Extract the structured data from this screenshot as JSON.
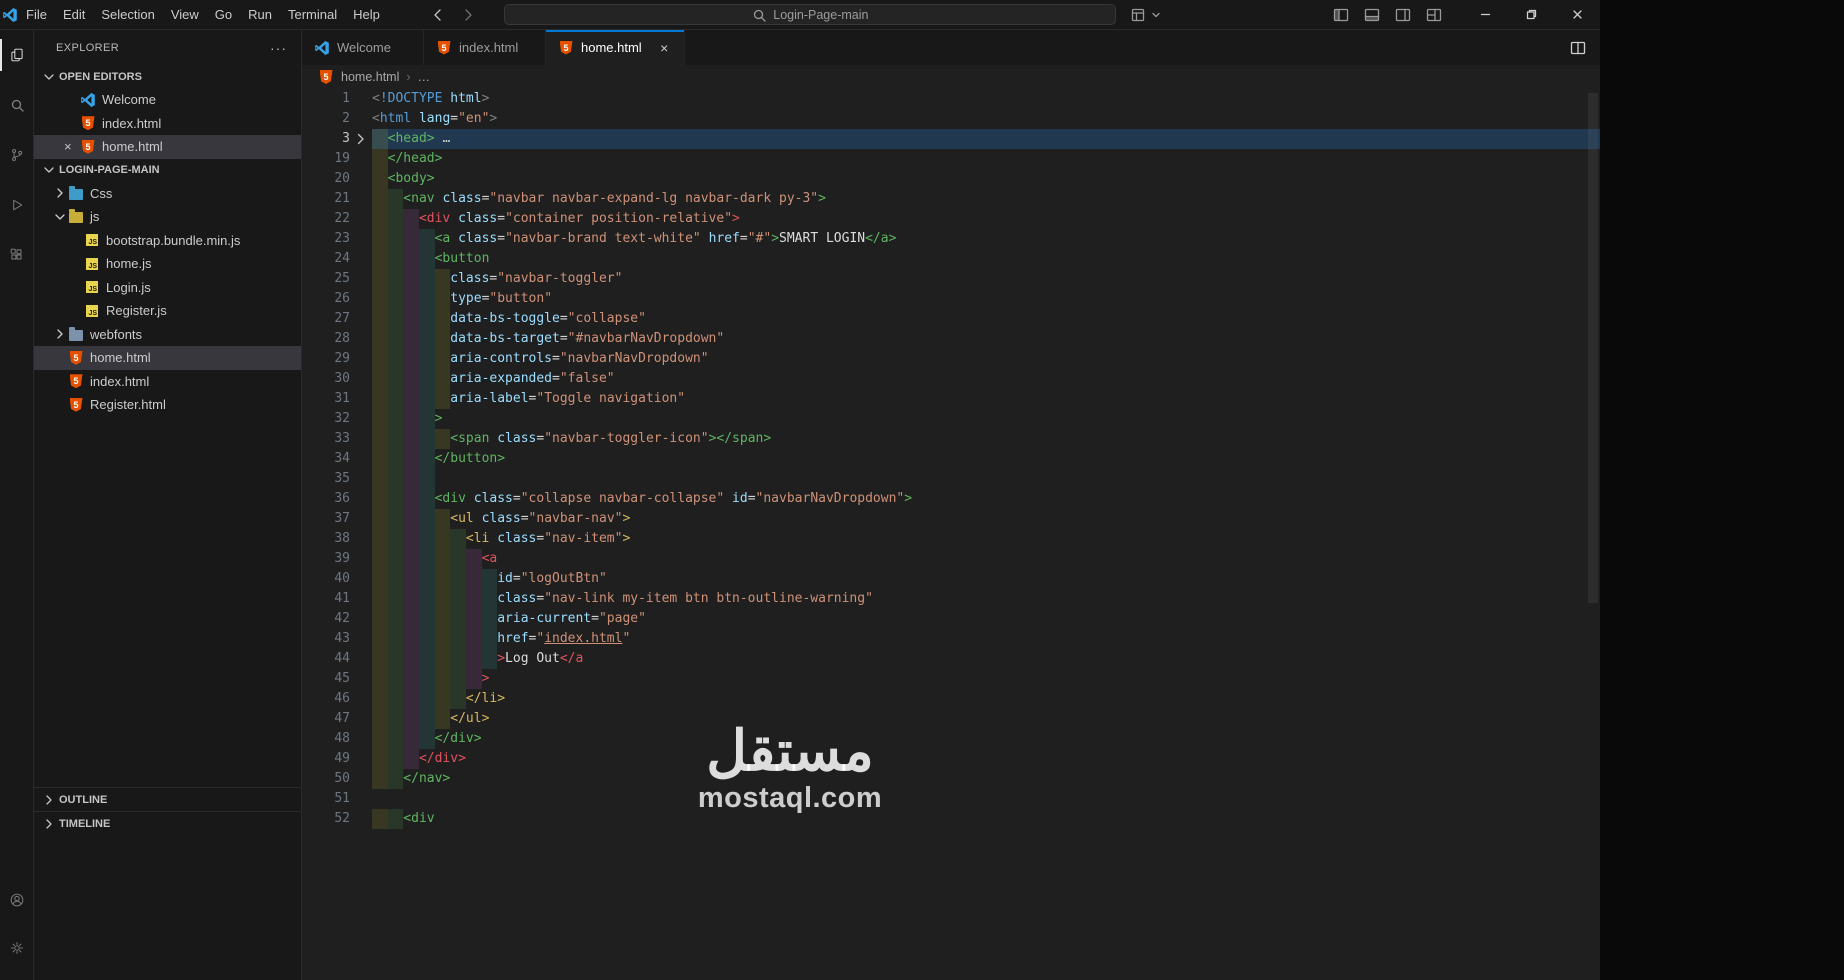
{
  "palette": {
    "accent_blue": "#0078d4",
    "html_icon_orange": "#e65100",
    "js_icon_yellow": "#e8d44d",
    "tag_green": "#5fb562",
    "tag_red": "#e0535e",
    "tag_yellow": "#d8b960",
    "attr_blue": "#9cdcfe",
    "value_orange": "#ce9178",
    "selection_highlight": "#204e78"
  },
  "titlebar": {
    "menus": [
      "File",
      "Edit",
      "Selection",
      "View",
      "Go",
      "Run",
      "Terminal",
      "Help"
    ],
    "nav_icons": [
      "back-arrow-icon",
      "forward-arrow-icon"
    ],
    "command_center": {
      "text": "Login-Page-main",
      "icon": "search-icon"
    },
    "extra_icons": [
      "layout-grid-icon",
      "chevron-small-down-icon"
    ],
    "layout_icons": [
      "layout-sidebar-icon",
      "layout-panel-icon",
      "layout-sidebar-right-icon",
      "layout-customize-icon"
    ],
    "window_controls": [
      "minimize-icon",
      "restore-icon",
      "close-icon"
    ]
  },
  "activity_bar": {
    "items": [
      {
        "icon": "files-icon",
        "active": true
      },
      {
        "icon": "search-icon",
        "active": false
      },
      {
        "icon": "source-control-icon",
        "active": false
      },
      {
        "icon": "run-debug-icon",
        "active": false
      },
      {
        "icon": "extensions-icon",
        "active": false
      }
    ],
    "bottom": [
      {
        "icon": "account-icon"
      },
      {
        "icon": "settings-gear-icon"
      }
    ]
  },
  "sidebar": {
    "title": "EXPLORER",
    "more_icon": "ellipsis-icon",
    "open_editors": {
      "label": "OPEN EDITORS",
      "chevron": "down",
      "items": [
        {
          "label": "Welcome",
          "icon": "vscode-icon",
          "selected": false,
          "closable": false
        },
        {
          "label": "index.html",
          "icon": "html5-icon",
          "selected": false,
          "closable": false
        },
        {
          "label": "home.html",
          "icon": "html5-icon",
          "selected": true,
          "closable": true
        }
      ]
    },
    "project": {
      "label": "LOGIN-PAGE-MAIN",
      "chevron": "down",
      "items": [
        {
          "label": "Css",
          "icon": "folder-css-icon",
          "chevron": "right",
          "depth": 0,
          "selected": false
        },
        {
          "label": "js",
          "icon": "folder-js-icon",
          "chevron": "down",
          "depth": 0,
          "selected": false
        },
        {
          "label": "bootstrap.bundle.min.js",
          "icon": "js-icon",
          "depth": 1,
          "selected": false
        },
        {
          "label": "home.js",
          "icon": "js-icon",
          "depth": 1,
          "selected": false
        },
        {
          "label": "Login.js",
          "icon": "js-icon",
          "depth": 1,
          "selected": false
        },
        {
          "label": "Register.js",
          "icon": "js-icon",
          "depth": 1,
          "selected": false
        },
        {
          "label": "webfonts",
          "icon": "folder-icon",
          "chevron": "right",
          "depth": 0,
          "selected": false
        },
        {
          "label": "home.html",
          "icon": "html5-icon",
          "depth": 0,
          "selected": true,
          "file": true
        },
        {
          "label": "index.html",
          "icon": "html5-icon",
          "depth": 0,
          "selected": false,
          "file": true
        },
        {
          "label": "Register.html",
          "icon": "html5-icon",
          "depth": 0,
          "selected": false,
          "file": true
        }
      ]
    },
    "outline_label": "OUTLINE",
    "timeline_label": "TIMELINE"
  },
  "editor": {
    "tabs": [
      {
        "label": "Welcome",
        "icon": "vscode-icon",
        "active": false
      },
      {
        "label": "index.html",
        "icon": "html5-icon",
        "active": false
      },
      {
        "label": "home.html",
        "icon": "html5-icon",
        "active": true,
        "close": "×"
      }
    ],
    "actions": [
      "split-editor-icon"
    ],
    "breadcrumb": {
      "icon": "html5-icon",
      "file": "home.html",
      "sep": "›",
      "ellipsis": "…"
    },
    "code": {
      "lines": [
        {
          "n": 1,
          "i": 0,
          "t": [
            [
              "p",
              "<"
            ],
            [
              "kw",
              "!DOCTYPE"
            ],
            [
              "w",
              " "
            ],
            [
              "at",
              "html"
            ],
            [
              "p",
              ">"
            ]
          ]
        },
        {
          "n": 2,
          "i": 0,
          "t": [
            [
              "p",
              "<"
            ],
            [
              "kw",
              "html"
            ],
            [
              "w",
              " "
            ],
            [
              "at",
              "lang"
            ],
            [
              "eq",
              "="
            ],
            [
              "v",
              "\"en\""
            ],
            [
              "p",
              ">"
            ]
          ]
        },
        {
          "n": 3,
          "i": 1,
          "hl": true,
          "fold": true,
          "t": [
            [
              "tg",
              "<head>"
            ],
            [
              "w",
              " "
            ],
            [
              "dots",
              "…"
            ]
          ]
        },
        {
          "n": 19,
          "i": 1,
          "t": [
            [
              "tg",
              "</head>"
            ]
          ]
        },
        {
          "n": 20,
          "i": 1,
          "t": [
            [
              "tg",
              "<body>"
            ]
          ]
        },
        {
          "n": 21,
          "i": 2,
          "t": [
            [
              "tg",
              "<nav"
            ],
            [
              "w",
              " "
            ],
            [
              "at",
              "class"
            ],
            [
              "eq",
              "="
            ],
            [
              "v",
              "\"navbar navbar-expand-lg navbar-dark py-3\""
            ],
            [
              "tg",
              ">"
            ]
          ]
        },
        {
          "n": 22,
          "i": 3,
          "t": [
            [
              "tr",
              "<div"
            ],
            [
              "w",
              " "
            ],
            [
              "at",
              "class"
            ],
            [
              "eq",
              "="
            ],
            [
              "v",
              "\"container position-relative\""
            ],
            [
              "tr",
              ">"
            ]
          ]
        },
        {
          "n": 23,
          "i": 4,
          "t": [
            [
              "tg",
              "<a"
            ],
            [
              "w",
              " "
            ],
            [
              "at",
              "class"
            ],
            [
              "eq",
              "="
            ],
            [
              "v",
              "\"navbar-brand text-white\""
            ],
            [
              "w",
              " "
            ],
            [
              "at",
              "href"
            ],
            [
              "eq",
              "="
            ],
            [
              "v",
              "\"#\""
            ],
            [
              "tg",
              ">"
            ],
            [
              "tx",
              "SMART LOGIN"
            ],
            [
              "tg",
              "</a>"
            ]
          ]
        },
        {
          "n": 24,
          "i": 4,
          "t": [
            [
              "tg",
              "<button"
            ]
          ]
        },
        {
          "n": 25,
          "i": 5,
          "t": [
            [
              "at",
              "class"
            ],
            [
              "eq",
              "="
            ],
            [
              "v",
              "\"navbar-toggler\""
            ]
          ]
        },
        {
          "n": 26,
          "i": 5,
          "t": [
            [
              "at",
              "type"
            ],
            [
              "eq",
              "="
            ],
            [
              "v",
              "\"button\""
            ]
          ]
        },
        {
          "n": 27,
          "i": 5,
          "t": [
            [
              "at",
              "data-bs-toggle"
            ],
            [
              "eq",
              "="
            ],
            [
              "v",
              "\"collapse\""
            ]
          ]
        },
        {
          "n": 28,
          "i": 5,
          "t": [
            [
              "at",
              "data-bs-target"
            ],
            [
              "eq",
              "="
            ],
            [
              "v",
              "\"#navbarNavDropdown\""
            ]
          ]
        },
        {
          "n": 29,
          "i": 5,
          "t": [
            [
              "at",
              "aria-controls"
            ],
            [
              "eq",
              "="
            ],
            [
              "v",
              "\"navbarNavDropdown\""
            ]
          ]
        },
        {
          "n": 30,
          "i": 5,
          "t": [
            [
              "at",
              "aria-expanded"
            ],
            [
              "eq",
              "="
            ],
            [
              "v",
              "\"false\""
            ]
          ]
        },
        {
          "n": 31,
          "i": 5,
          "t": [
            [
              "at",
              "aria-label"
            ],
            [
              "eq",
              "="
            ],
            [
              "v",
              "\"Toggle navigation\""
            ]
          ]
        },
        {
          "n": 32,
          "i": 4,
          "t": [
            [
              "tg",
              ">"
            ]
          ]
        },
        {
          "n": 33,
          "i": 5,
          "t": [
            [
              "tg",
              "<span"
            ],
            [
              "w",
              " "
            ],
            [
              "at",
              "class"
            ],
            [
              "eq",
              "="
            ],
            [
              "v",
              "\"navbar-toggler-icon\""
            ],
            [
              "tg",
              "></span>"
            ]
          ]
        },
        {
          "n": 34,
          "i": 4,
          "t": [
            [
              "tg",
              "</button>"
            ]
          ]
        },
        {
          "n": 35,
          "i": 4,
          "t": []
        },
        {
          "n": 36,
          "i": 4,
          "t": [
            [
              "tg",
              "<div"
            ],
            [
              "w",
              " "
            ],
            [
              "at",
              "class"
            ],
            [
              "eq",
              "="
            ],
            [
              "v",
              "\"collapse navbar-collapse\""
            ],
            [
              "w",
              " "
            ],
            [
              "at",
              "id"
            ],
            [
              "eq",
              "="
            ],
            [
              "v",
              "\"navbarNavDropdown\""
            ],
            [
              "tg",
              ">"
            ]
          ]
        },
        {
          "n": 37,
          "i": 5,
          "t": [
            [
              "ty",
              "<ul"
            ],
            [
              "w",
              " "
            ],
            [
              "at",
              "class"
            ],
            [
              "eq",
              "="
            ],
            [
              "v",
              "\"navbar-nav\""
            ],
            [
              "ty",
              ">"
            ]
          ]
        },
        {
          "n": 38,
          "i": 6,
          "t": [
            [
              "ty",
              "<li"
            ],
            [
              "w",
              " "
            ],
            [
              "at",
              "class"
            ],
            [
              "eq",
              "="
            ],
            [
              "v",
              "\"nav-item\""
            ],
            [
              "ty",
              ">"
            ]
          ]
        },
        {
          "n": 39,
          "i": 7,
          "t": [
            [
              "tr",
              "<a"
            ]
          ]
        },
        {
          "n": 40,
          "i": 8,
          "t": [
            [
              "at",
              "id"
            ],
            [
              "eq",
              "="
            ],
            [
              "v",
              "\"logOutBtn\""
            ]
          ]
        },
        {
          "n": 41,
          "i": 8,
          "t": [
            [
              "at",
              "class"
            ],
            [
              "eq",
              "="
            ],
            [
              "v",
              "\"nav-link my-item btn btn-outline-warning\""
            ]
          ]
        },
        {
          "n": 42,
          "i": 8,
          "t": [
            [
              "at",
              "aria-current"
            ],
            [
              "eq",
              "="
            ],
            [
              "v",
              "\"page\""
            ]
          ]
        },
        {
          "n": 43,
          "i": 8,
          "t": [
            [
              "at",
              "href"
            ],
            [
              "eq",
              "="
            ],
            [
              "v",
              "\""
            ],
            [
              "vl",
              "index.html"
            ],
            [
              "v",
              "\""
            ]
          ]
        },
        {
          "n": 44,
          "i": 8,
          "t": [
            [
              "tr",
              ">"
            ],
            [
              "tx",
              "Log Out"
            ],
            [
              "tr",
              "</a"
            ]
          ]
        },
        {
          "n": 45,
          "i": 7,
          "t": [
            [
              "tr",
              ">"
            ]
          ]
        },
        {
          "n": 46,
          "i": 6,
          "t": [
            [
              "ty",
              "</li>"
            ]
          ]
        },
        {
          "n": 47,
          "i": 5,
          "t": [
            [
              "ty",
              "</ul>"
            ]
          ]
        },
        {
          "n": 48,
          "i": 4,
          "t": [
            [
              "tg",
              "</div>"
            ]
          ]
        },
        {
          "n": 49,
          "i": 3,
          "t": [
            [
              "tr",
              "</div>"
            ]
          ]
        },
        {
          "n": 50,
          "i": 2,
          "t": [
            [
              "tg",
              "</nav>"
            ]
          ]
        },
        {
          "n": 51,
          "i": 0,
          "t": []
        },
        {
          "n": 52,
          "i": 2,
          "t": [
            [
              "tg",
              "<div"
            ]
          ]
        }
      ]
    }
  },
  "watermark": {
    "arabic": "مستقل",
    "latin": "mostaql.com"
  }
}
